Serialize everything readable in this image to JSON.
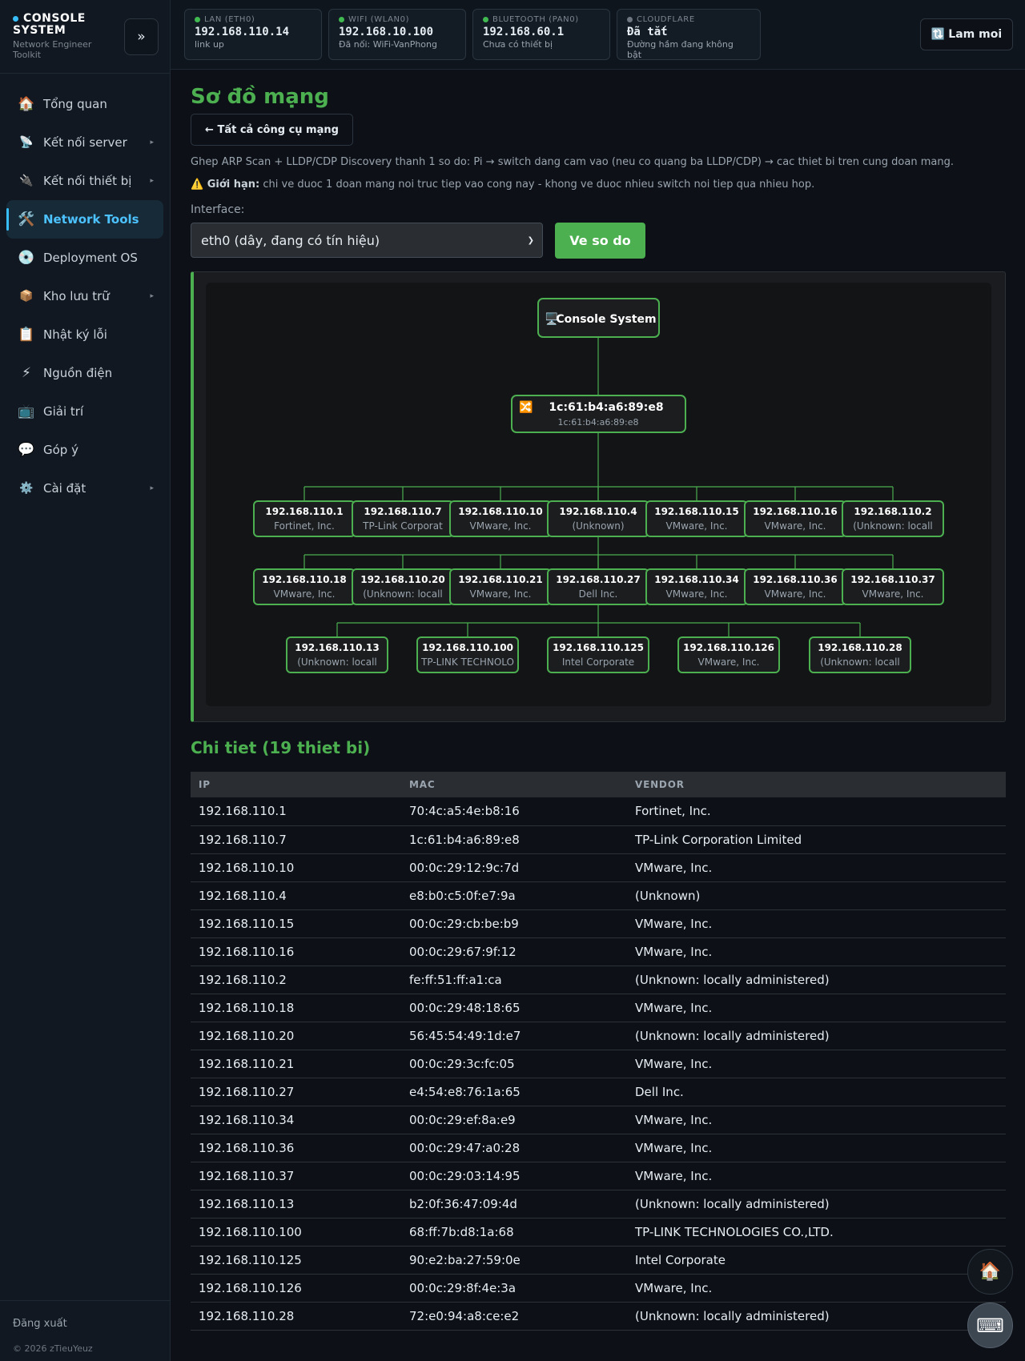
{
  "brand": {
    "title": "CONSOLE SYSTEM",
    "subtitle": "Network Engineer Toolkit",
    "collapse": "»"
  },
  "sidebar": {
    "items": [
      {
        "icon": "🏠",
        "label": "Tổng quan",
        "caret": ""
      },
      {
        "icon": "📡",
        "label": "Kết nối server",
        "caret": "▸"
      },
      {
        "icon": "🔌",
        "label": "Kết nối thiết bị",
        "caret": "▸"
      },
      {
        "icon": "🛠️",
        "label": "Network Tools",
        "caret": ""
      },
      {
        "icon": "💿",
        "label": "Deployment OS",
        "caret": ""
      },
      {
        "icon": "📦",
        "label": "Kho lưu trữ",
        "caret": "▸"
      },
      {
        "icon": "📋",
        "label": "Nhật ký lỗi",
        "caret": ""
      },
      {
        "icon": "⚡",
        "label": "Nguồn điện",
        "caret": ""
      },
      {
        "icon": "📺",
        "label": "Giải trí",
        "caret": ""
      },
      {
        "icon": "💬",
        "label": "Góp ý",
        "caret": ""
      },
      {
        "icon": "⚙️",
        "label": "Cài đặt",
        "caret": "▸"
      }
    ],
    "logout": "Đăng xuất",
    "copyright": "© 2026 zTieuYeuz"
  },
  "topbar": {
    "cards": [
      {
        "label": "LAN (ETH0)",
        "value": "192.168.110.14",
        "status": "link up",
        "color": "#3fb950"
      },
      {
        "label": "WIFI (WLAN0)",
        "value": "192.168.10.100",
        "status": "Đã nối: WiFi-VanPhong",
        "color": "#3fb950"
      },
      {
        "label": "BLUETOOTH (PAN0)",
        "value": "192.168.60.1",
        "status": "Chưa có thiết bị",
        "color": "#3fb950"
      },
      {
        "label": "CLOUDFLARE",
        "value": "Đã tắt",
        "status": "Đường hầm đang không bật",
        "color": "#6e7681"
      }
    ],
    "refresh_icon": "🔃",
    "refresh_label": "Lam moi"
  },
  "page": {
    "title": "Sơ đồ mạng",
    "back_label": "← Tất cả công cụ mạng",
    "description": "Ghep ARP Scan + LLDP/CDP Discovery thanh 1 so do: Pi → switch dang cam vao (neu co quang ba LLDP/CDP) → cac thiet bi tren cung doan mang.",
    "limit_prefix": "⚠️ Giới hạn:",
    "limit_text": " chi ve duoc 1 doan mang noi truc tiep vao cong nay - khong ve duoc nhieu switch noi tiep qua nhieu hop.",
    "interface_label": "Interface:",
    "interface_value": "eth0 (dây, đang có tín hiệu)",
    "draw_label": "Ve so do",
    "detail_title": "Chi tiet (19 thiet bi)"
  },
  "diagram": {
    "root": {
      "icon": "🖥️",
      "label": "Console System"
    },
    "switch": {
      "icon": "🔀",
      "label": "1c:61:b4:a6:89:e8",
      "sub": "1c:61:b4:a6:89:e8"
    },
    "devices": [
      {
        "ip": "192.168.110.1",
        "vendor": "Fortinet, Inc."
      },
      {
        "ip": "192.168.110.7",
        "vendor": "TP-Link Corporat"
      },
      {
        "ip": "192.168.110.10",
        "vendor": "VMware, Inc."
      },
      {
        "ip": "192.168.110.4",
        "vendor": "(Unknown)"
      },
      {
        "ip": "192.168.110.15",
        "vendor": "VMware, Inc."
      },
      {
        "ip": "192.168.110.16",
        "vendor": "VMware, Inc."
      },
      {
        "ip": "192.168.110.2",
        "vendor": "(Unknown: locall"
      },
      {
        "ip": "192.168.110.18",
        "vendor": "VMware, Inc."
      },
      {
        "ip": "192.168.110.20",
        "vendor": "(Unknown: locall"
      },
      {
        "ip": "192.168.110.21",
        "vendor": "VMware, Inc."
      },
      {
        "ip": "192.168.110.27",
        "vendor": "Dell Inc."
      },
      {
        "ip": "192.168.110.34",
        "vendor": "VMware, Inc."
      },
      {
        "ip": "192.168.110.36",
        "vendor": "VMware, Inc."
      },
      {
        "ip": "192.168.110.37",
        "vendor": "VMware, Inc."
      },
      {
        "ip": "192.168.110.13",
        "vendor": "(Unknown: locall"
      },
      {
        "ip": "192.168.110.100",
        "vendor": "TP-LINK TECHNOLO"
      },
      {
        "ip": "192.168.110.125",
        "vendor": "Intel Corporate"
      },
      {
        "ip": "192.168.110.126",
        "vendor": "VMware, Inc."
      },
      {
        "ip": "192.168.110.28",
        "vendor": "(Unknown: locall"
      }
    ]
  },
  "table": {
    "headers": [
      "IP",
      "MAC",
      "VENDOR"
    ],
    "rows": [
      [
        "192.168.110.1",
        "70:4c:a5:4e:b8:16",
        "Fortinet, Inc."
      ],
      [
        "192.168.110.7",
        "1c:61:b4:a6:89:e8",
        "TP-Link Corporation Limited"
      ],
      [
        "192.168.110.10",
        "00:0c:29:12:9c:7d",
        "VMware, Inc."
      ],
      [
        "192.168.110.4",
        "e8:b0:c5:0f:e7:9a",
        "(Unknown)"
      ],
      [
        "192.168.110.15",
        "00:0c:29:cb:be:b9",
        "VMware, Inc."
      ],
      [
        "192.168.110.16",
        "00:0c:29:67:9f:12",
        "VMware, Inc."
      ],
      [
        "192.168.110.2",
        "fe:ff:51:ff:a1:ca",
        "(Unknown: locally administered)"
      ],
      [
        "192.168.110.18",
        "00:0c:29:48:18:65",
        "VMware, Inc."
      ],
      [
        "192.168.110.20",
        "56:45:54:49:1d:e7",
        "(Unknown: locally administered)"
      ],
      [
        "192.168.110.21",
        "00:0c:29:3c:fc:05",
        "VMware, Inc."
      ],
      [
        "192.168.110.27",
        "e4:54:e8:76:1a:65",
        "Dell Inc."
      ],
      [
        "192.168.110.34",
        "00:0c:29:ef:8a:e9",
        "VMware, Inc."
      ],
      [
        "192.168.110.36",
        "00:0c:29:47:a0:28",
        "VMware, Inc."
      ],
      [
        "192.168.110.37",
        "00:0c:29:03:14:95",
        "VMware, Inc."
      ],
      [
        "192.168.110.13",
        "b2:0f:36:47:09:4d",
        "(Unknown: locally administered)"
      ],
      [
        "192.168.110.100",
        "68:ff:7b:d8:1a:68",
        "TP-LINK TECHNOLOGIES CO.,LTD."
      ],
      [
        "192.168.110.125",
        "90:e2:ba:27:59:0e",
        "Intel Corporate"
      ],
      [
        "192.168.110.126",
        "00:0c:29:8f:4e:3a",
        "VMware, Inc."
      ],
      [
        "192.168.110.28",
        "72:e0:94:a8:ce:e2",
        "(Unknown: locally administered)"
      ]
    ]
  },
  "fab": {
    "home_icon": "🏠",
    "keyboard_icon": "⌨"
  }
}
